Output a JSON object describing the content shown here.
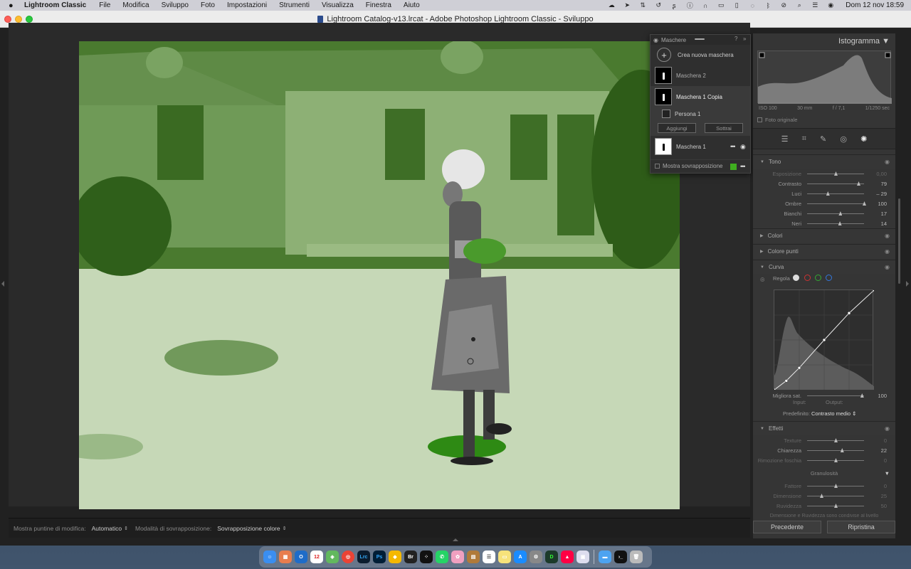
{
  "menubar": {
    "app": "Lightroom Classic",
    "items": [
      "File",
      "Modifica",
      "Sviluppo",
      "Foto",
      "Impostazioni",
      "Strumenti",
      "Visualizza",
      "Finestra",
      "Aiuto"
    ],
    "clock": "Dom 12 nov  18:59"
  },
  "window": {
    "title": "Lightroom Catalog-v13.lrcat - Adobe Photoshop Lightroom Classic - Sviluppo"
  },
  "masks_panel": {
    "title": "Maschere",
    "create_label": "Crea nuova maschera",
    "masks": [
      {
        "name": "Maschera 2"
      },
      {
        "name": "Maschera 1 Copia"
      },
      {
        "name": "Maschera 1"
      }
    ],
    "component": "Persona 1",
    "add_label": "Aggiungi",
    "subtract_label": "Sottrai",
    "show_overlay_label": "Mostra sovrapposizione",
    "overlay_color": "#3fae1f"
  },
  "toolbar": {
    "pins_label": "Mostra puntine di modifica:",
    "pins_value": "Automatico",
    "overlay_mode_label": "Modalità di sovrapposizione:",
    "overlay_mode_value": "Sovrapposizione colore"
  },
  "right_panel": {
    "histogram_title": "Istogramma",
    "meta": {
      "iso": "ISO 100",
      "focal": "30 mm",
      "aperture": "f / 7,1",
      "shutter": "1/1250 sec"
    },
    "original_label": "Foto originale",
    "tone": {
      "title": "Tono",
      "sliders": [
        {
          "name": "Esposizione",
          "value": "0,00",
          "pos": 0.5,
          "dim": true
        },
        {
          "name": "Contrasto",
          "value": "79",
          "pos": 0.9,
          "dim": false
        },
        {
          "name": "Luci",
          "value": "– 29",
          "pos": 0.36,
          "dim": false
        },
        {
          "name": "Ombre",
          "value": "100",
          "pos": 1.0,
          "dim": false
        },
        {
          "name": "Bianchi",
          "value": "17",
          "pos": 0.58,
          "dim": false
        },
        {
          "name": "Neri",
          "value": "14",
          "pos": 0.57,
          "dim": false
        }
      ]
    },
    "colors_title": "Colori",
    "color_points_title": "Colore punti",
    "curve": {
      "title": "Curva",
      "adjust_label": "Regola",
      "refine_label": "Migliora sat.",
      "refine_value": "100",
      "input_label": "Input:",
      "output_label": "Output:",
      "preset_label": "Predefinito:",
      "preset_value": "Contrasto medio",
      "points": [
        [
          0,
          0
        ],
        [
          0.12,
          0.09
        ],
        [
          0.25,
          0.22
        ],
        [
          0.5,
          0.5
        ],
        [
          0.75,
          0.77
        ],
        [
          1,
          1
        ]
      ]
    },
    "effects": {
      "title": "Effetti",
      "sliders": [
        {
          "name": "Texture",
          "value": "0",
          "pos": 0.5,
          "dim": true
        },
        {
          "name": "Chiarezza",
          "value": "22",
          "pos": 0.61,
          "dim": false
        },
        {
          "name": "Rimozione foschia",
          "value": "0",
          "pos": 0.5,
          "dim": true
        }
      ],
      "grain_title": "Granulosità",
      "grain_sliders": [
        {
          "name": "Fattore",
          "value": "0",
          "pos": 0.5,
          "dim": true
        },
        {
          "name": "Dimensione",
          "value": "25",
          "pos": 0.25,
          "dim": true
        },
        {
          "name": "Ruvidezza",
          "value": "50",
          "pos": 0.5,
          "dim": true
        }
      ],
      "note": "Dimensione e Ruvidezza sono condivise al livello"
    },
    "prev_button": "Precedente",
    "reset_button": "Ripristina"
  },
  "dock": {
    "apps": [
      "Finder",
      "Launchpad",
      "Outlook",
      "Calendar",
      "Maps",
      "Chrome",
      "Lrc",
      "Ps",
      "Sketch",
      "Br",
      "Dots",
      "WhatsApp",
      "Photos",
      "Notes",
      "Reminders",
      "Stickies",
      "App Store",
      "Settings",
      "Dash",
      "Affinity",
      "Preview",
      "Downloads",
      "Terminal",
      "Trash"
    ],
    "labels": {
      "lrc": "Lrc",
      "ps": "Ps",
      "br": "Br"
    },
    "calendar_day": "12"
  }
}
